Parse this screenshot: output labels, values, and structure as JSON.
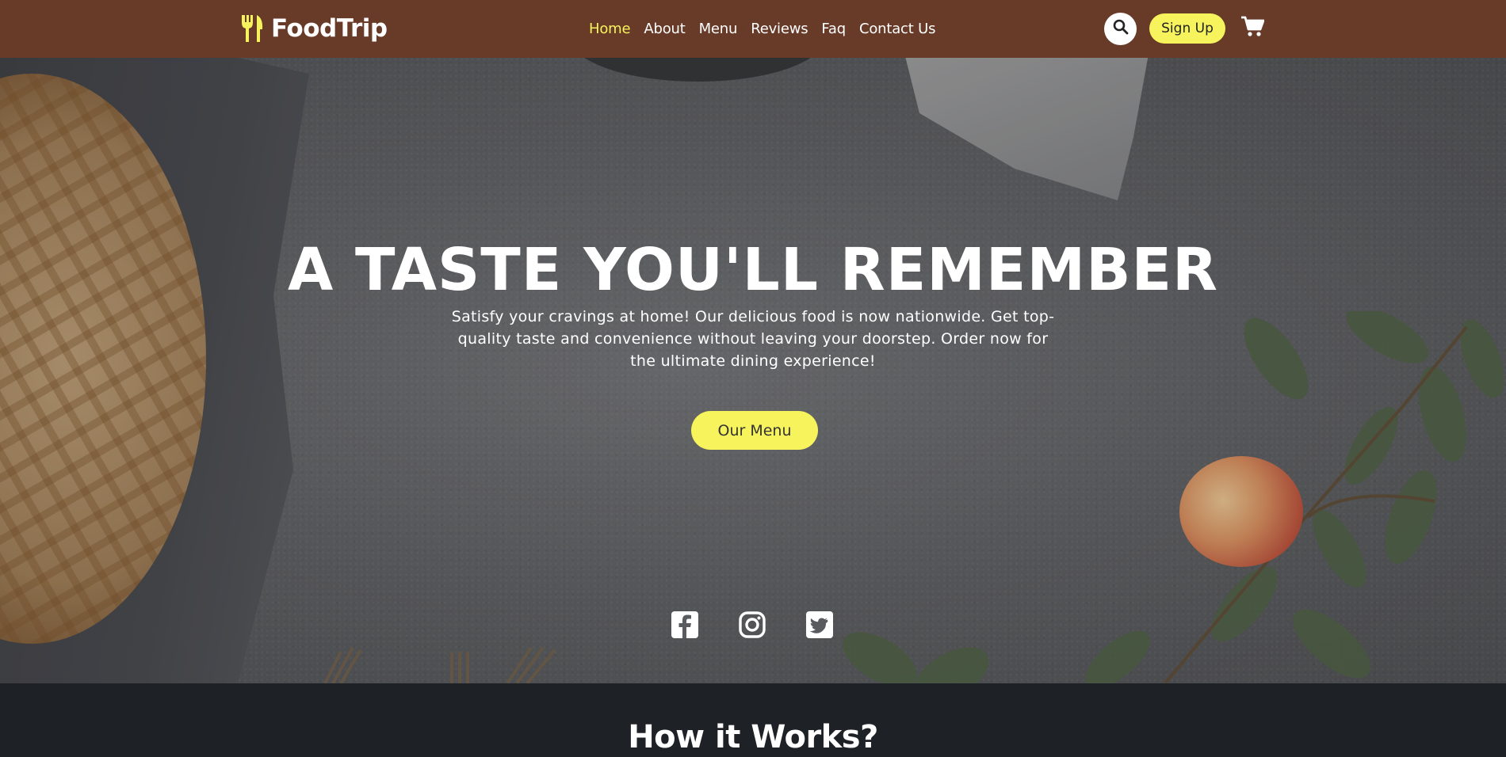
{
  "brand": {
    "name": "FoodTrip",
    "accent": "#f7f35d",
    "nav_bg": "#683a28"
  },
  "nav": {
    "links": [
      {
        "label": "Home",
        "active": true
      },
      {
        "label": "About"
      },
      {
        "label": "Menu"
      },
      {
        "label": "Reviews"
      },
      {
        "label": "Faq"
      },
      {
        "label": "Contact Us"
      }
    ],
    "signup_label": "Sign Up",
    "icons": [
      "search-icon",
      "cart-icon"
    ]
  },
  "hero": {
    "title": "A TASTE YOU'LL REMEMBER",
    "description": "Satisfy your cravings at home! Our delicious food is now nationwide. Get top-quality taste and convenience without leaving your doorstep. Order now for the ultimate dining experience!",
    "cta_label": "Our Menu",
    "socials": [
      "facebook-icon",
      "instagram-icon",
      "twitter-icon"
    ]
  },
  "how": {
    "title": "How it Works?"
  }
}
